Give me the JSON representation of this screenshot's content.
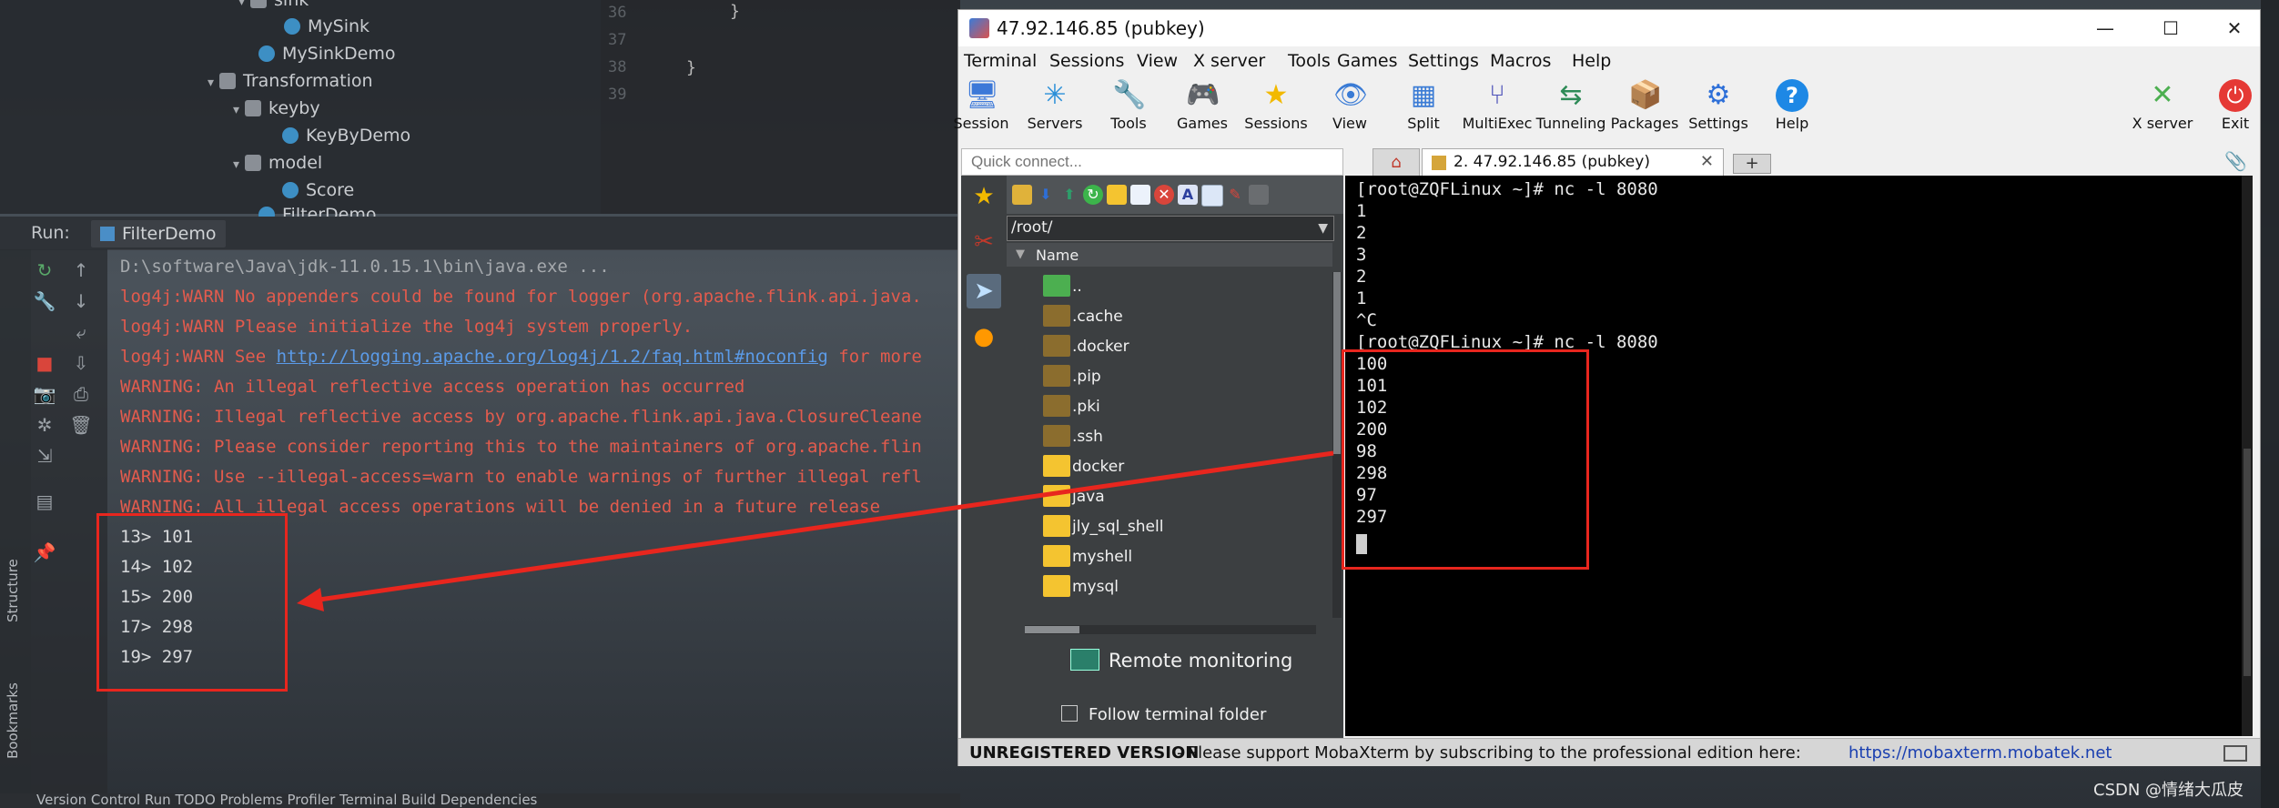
{
  "ide": {
    "tree": [
      {
        "label": "sink",
        "kind": "folder"
      },
      {
        "label": "MySink",
        "kind": "class"
      },
      {
        "label": "MySinkDemo",
        "kind": "class"
      },
      {
        "label": "Transformation",
        "kind": "folder"
      },
      {
        "label": "keyby",
        "kind": "folder"
      },
      {
        "label": "KeyByDemo",
        "kind": "class"
      },
      {
        "label": "model",
        "kind": "folder"
      },
      {
        "label": "Score",
        "kind": "class"
      },
      {
        "label": "FilterDemo",
        "kind": "class"
      }
    ],
    "gutter": [
      "36",
      "37",
      "38",
      "39"
    ],
    "code": [
      "}",
      "}"
    ],
    "run_label": "Run:",
    "run_tab": "FilterDemo",
    "side_labels": [
      "Structure",
      "Bookmarks"
    ],
    "console": [
      {
        "text": "D:\\software\\Java\\jdk-11.0.15.1\\bin\\java.exe ...",
        "style": "gray"
      },
      {
        "text": "log4j:WARN No appenders could be found for logger (org.apache.flink.api.java.",
        "style": "red"
      },
      {
        "text": "log4j:WARN Please initialize the log4j system properly.",
        "style": "red"
      },
      {
        "text_pre": "log4j:WARN See ",
        "link": "http://logging.apache.org/log4j/1.2/faq.html#noconfig",
        "text_post": " for more",
        "style": "red"
      },
      {
        "text": "WARNING: An illegal reflective access operation has occurred",
        "style": "red"
      },
      {
        "text": "WARNING: Illegal reflective access by org.apache.flink.api.java.ClosureCleane",
        "style": "red"
      },
      {
        "text": "WARNING: Please consider reporting this to the maintainers of org.apache.flin",
        "style": "red"
      },
      {
        "text": "WARNING: Use --illegal-access=warn to enable warnings of further illegal refl",
        "style": "red"
      },
      {
        "text": "WARNING: All illegal access operations will be denied in a future release",
        "style": "red"
      },
      {
        "text": "13> 101",
        "style": "out"
      },
      {
        "text": "14> 102",
        "style": "out"
      },
      {
        "text": "15> 200",
        "style": "out"
      },
      {
        "text": "17> 298",
        "style": "out"
      },
      {
        "text": "19> 297",
        "style": "out"
      }
    ],
    "bottom_tabs": "Version Control   Run   TODO   Problems   Profiler   Terminal   Build   Dependencies"
  },
  "moba": {
    "title": "47.92.146.85 (pubkey)",
    "menu": [
      "Terminal",
      "Sessions",
      "View",
      "X server",
      "Tools",
      "Games",
      "Settings",
      "Macros",
      "Help"
    ],
    "toolbar": [
      {
        "label": "Session",
        "icon": "monitor-icon",
        "glyph": "🖥"
      },
      {
        "label": "Servers",
        "icon": "servers-icon",
        "glyph": "✳"
      },
      {
        "label": "Tools",
        "icon": "tools-icon",
        "glyph": "🔧"
      },
      {
        "label": "Games",
        "icon": "gamepad-icon",
        "glyph": "🎮"
      },
      {
        "label": "Sessions",
        "icon": "star-icon",
        "glyph": "★"
      },
      {
        "label": "View",
        "icon": "view-icon",
        "glyph": "👁"
      },
      {
        "label": "Split",
        "icon": "split-icon",
        "glyph": "▦"
      },
      {
        "label": "MultiExec",
        "icon": "multiexec-icon",
        "glyph": "⑂"
      },
      {
        "label": "Tunneling",
        "icon": "tunneling-icon",
        "glyph": "⇆"
      },
      {
        "label": "Packages",
        "icon": "packages-icon",
        "glyph": "📦"
      },
      {
        "label": "Settings",
        "icon": "settings-icon",
        "glyph": "⚙"
      },
      {
        "label": "Help",
        "icon": "help-icon",
        "glyph": "?"
      }
    ],
    "toolbar_right": [
      {
        "label": "X server",
        "icon": "xserver-icon",
        "glyph": "✕"
      },
      {
        "label": "Exit",
        "icon": "power-icon",
        "glyph": "⏻"
      }
    ],
    "quick_connect_placeholder": "Quick connect...",
    "session_tab": "2. 47.92.146.85 (pubkey)",
    "sftp": {
      "path": "/root/",
      "column": "Name",
      "files": [
        {
          "name": "..",
          "type": "up"
        },
        {
          "name": ".cache",
          "type": "hidden"
        },
        {
          "name": ".docker",
          "type": "hidden"
        },
        {
          "name": ".pip",
          "type": "hidden"
        },
        {
          "name": ".pki",
          "type": "hidden"
        },
        {
          "name": ".ssh",
          "type": "hidden"
        },
        {
          "name": "docker",
          "type": "folder"
        },
        {
          "name": "java",
          "type": "folder"
        },
        {
          "name": "jly_sql_shell",
          "type": "folder"
        },
        {
          "name": "myshell",
          "type": "folder"
        },
        {
          "name": "mysql",
          "type": "folder"
        }
      ],
      "remote_monitoring": "Remote monitoring",
      "follow_folder": "Follow terminal folder"
    },
    "terminal": [
      "[root@ZQFLinux ~]# nc -l 8080",
      "1",
      "2",
      "3",
      "2",
      "1",
      "^C",
      "[root@ZQFLinux ~]# nc -l 8080",
      "100",
      "101",
      "102",
      "200",
      "98",
      "298",
      "97",
      "297"
    ],
    "status": {
      "bold": "UNREGISTERED VERSION",
      "text": " -  Please support MobaXterm by subscribing to the professional edition here:",
      "link": "https://mobaxterm.mobatek.net"
    }
  },
  "watermark": "CSDN @情绪大瓜皮",
  "colors": {
    "annotation": "#e8261e",
    "warning_text": "#e35b4d",
    "link": "#5b9be8"
  }
}
